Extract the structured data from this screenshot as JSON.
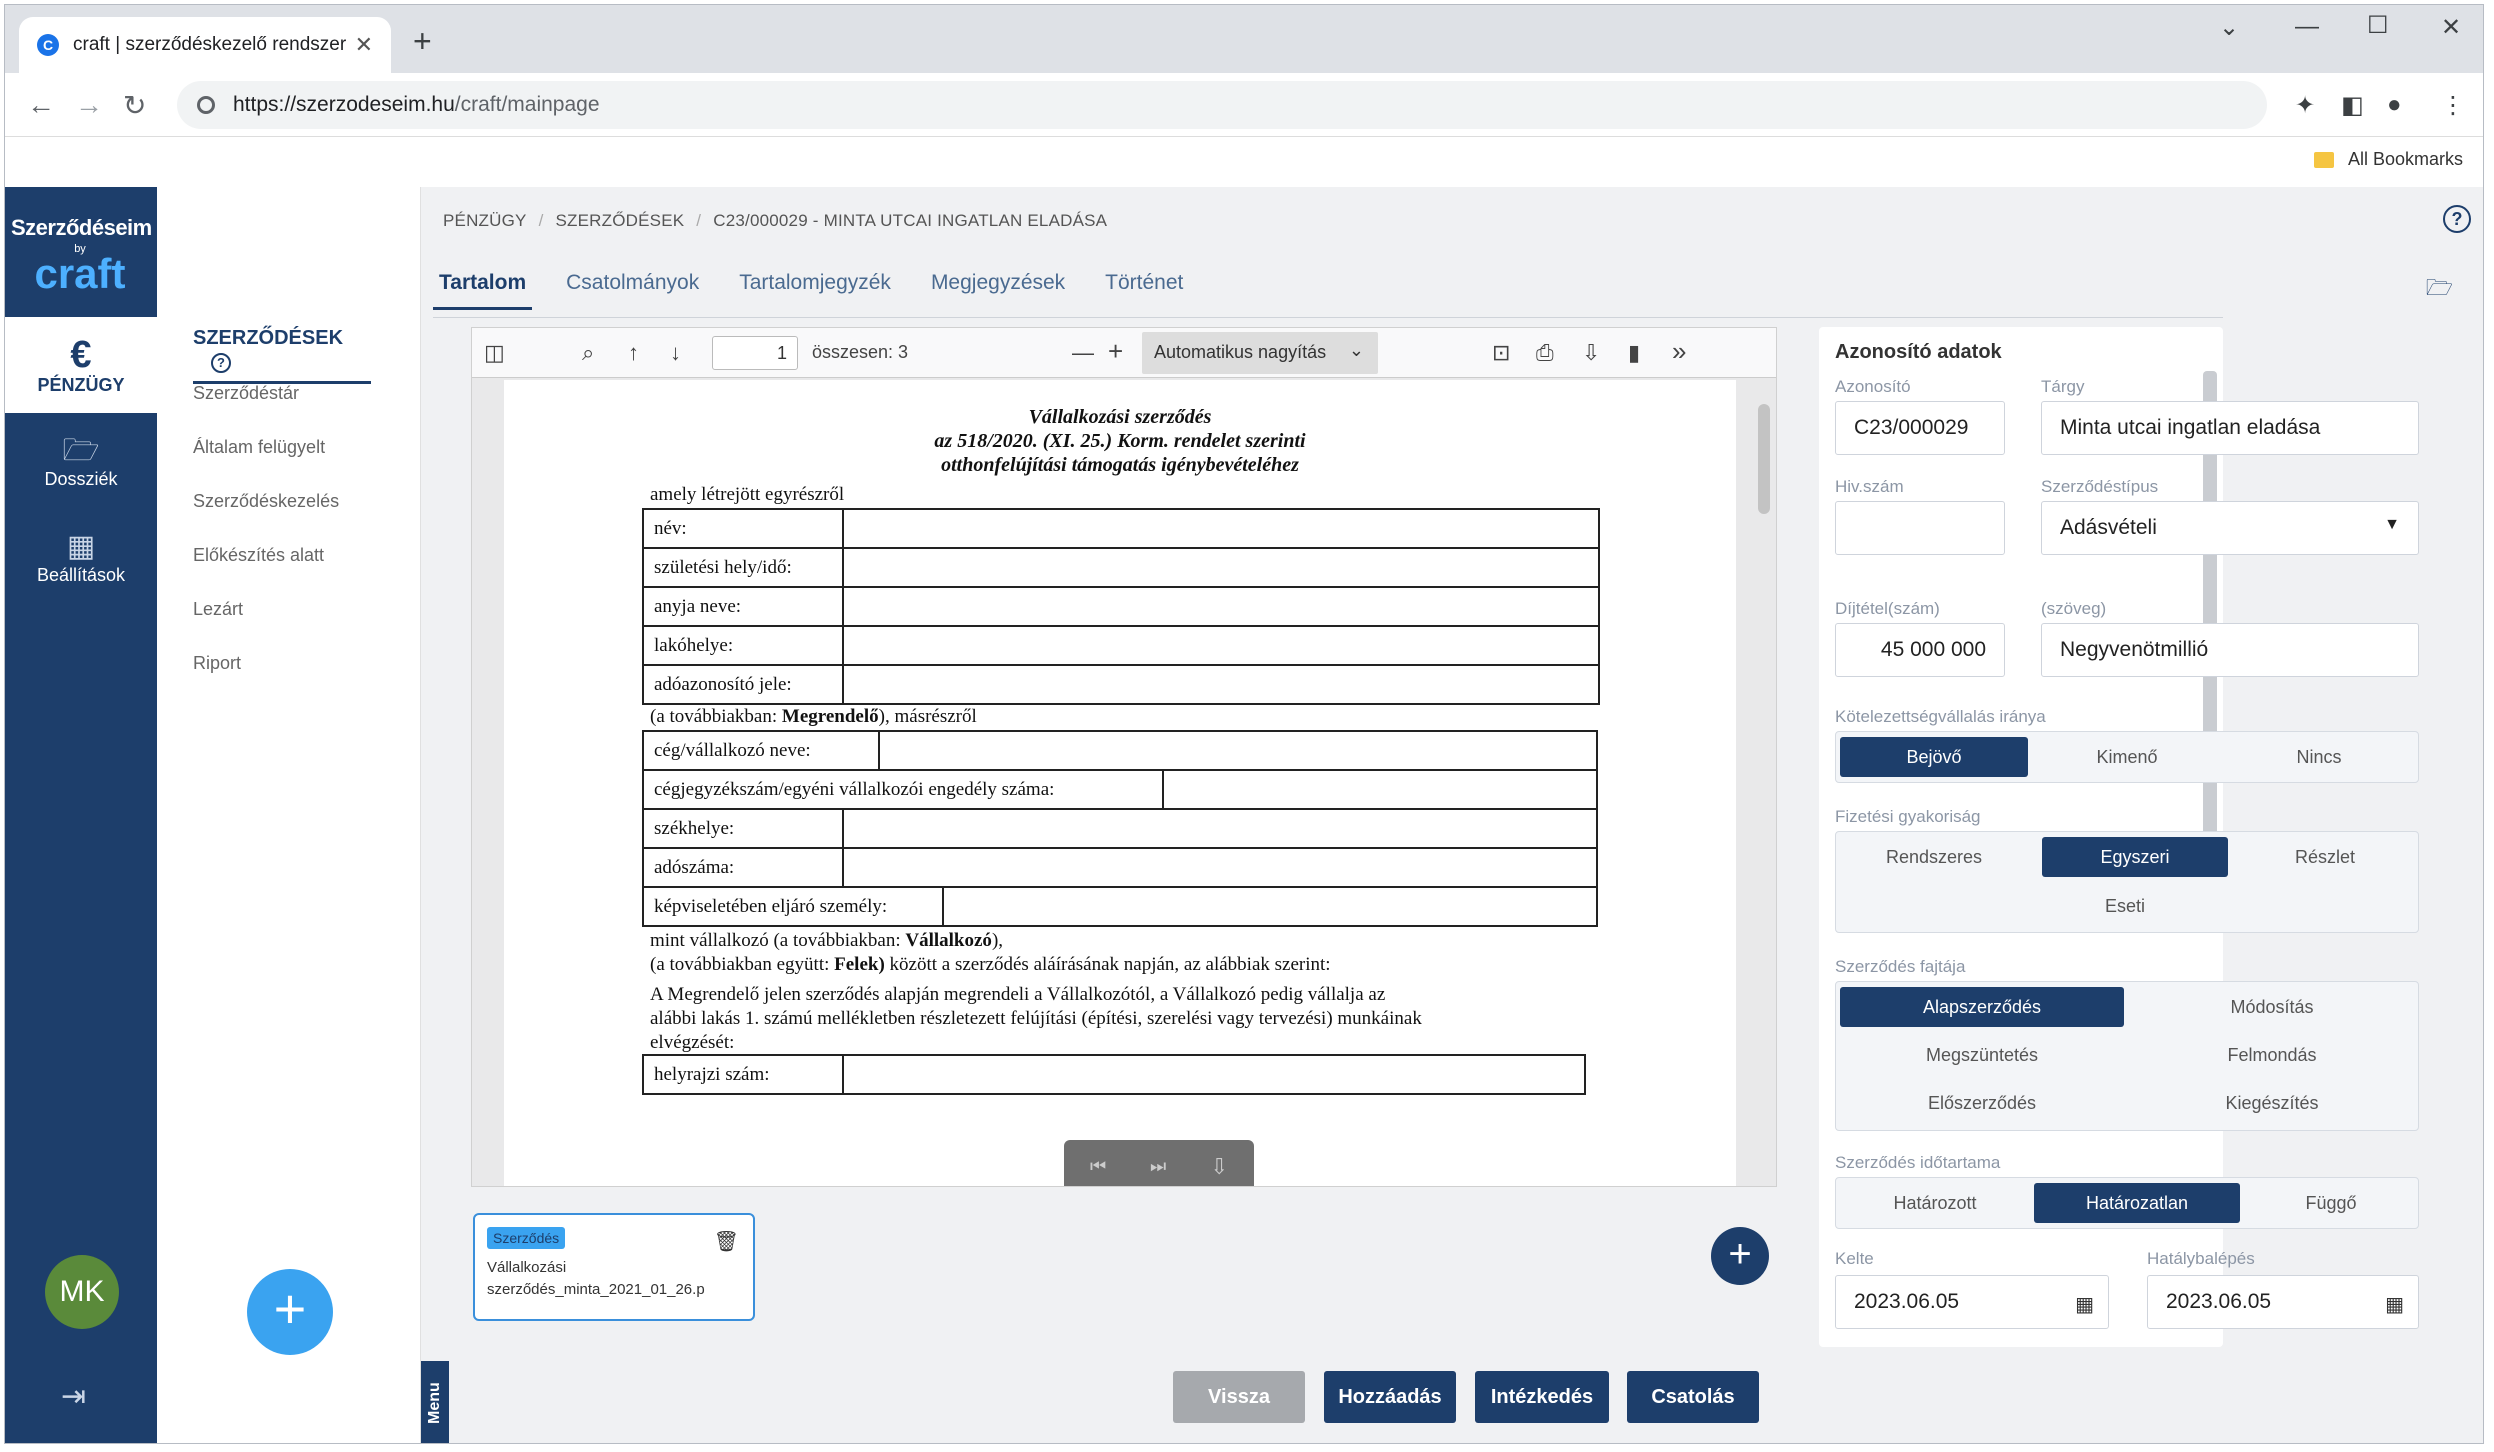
{
  "browser": {
    "tab_title": "craft | szerződéskezelő rendszer",
    "url_host": "https://szerzodeseim.hu",
    "url_path": "/craft/mainpage",
    "bookmarks_label": "All Bookmarks"
  },
  "rail": {
    "logo_line1": "Szerződéseim",
    "logo_line2": "by",
    "logo_line3": "craft",
    "items": [
      {
        "label": "PÉNZÜGY",
        "icon": "euro-icon"
      },
      {
        "label": "Dossziék",
        "icon": "folder-icon"
      },
      {
        "label": "Beállítások",
        "icon": "building-icon"
      }
    ],
    "avatar": "MK"
  },
  "sidebar": {
    "heading": "SZERZŐDÉSEK",
    "links": [
      "Szerződéstár",
      "Általam felügyelt",
      "Szerződéskezelés",
      "Előkészítés alatt",
      "Lezárt",
      "Riport"
    ]
  },
  "breadcrumb": [
    "PÉNZÜGY",
    "SZERZŐDÉSEK",
    "C23/000029 - MINTA UTCAI INGATLAN ELADÁSA"
  ],
  "tabs": [
    "Tartalom",
    "Csatolmányok",
    "Tartalomjegyzék",
    "Megjegyzések",
    "Történet"
  ],
  "viewer": {
    "page_number": "1",
    "page_total": "összesen: 3",
    "zoom": "Automatikus nagyítás"
  },
  "document": {
    "title1": "Vállalkozási szerződés",
    "title2": "az 518/2020. (XI. 25.) Korm. rendelet szerinti",
    "title3": "otthonfelújítási támogatás igénybevételéhez",
    "intro": "amely létrejött egyrészről",
    "party1_rows": [
      "név:",
      "születési hely/idő:",
      "anyja neve:",
      "lakóhelye:",
      "adóazonosító jele:"
    ],
    "party1_note_a": "(a továbbiakban: ",
    "party1_note_b": "Megrendelő",
    "party1_note_c": "), másrészről",
    "party2_rows": [
      "cég/vállalkozó neve:",
      "cégjegyzékszám/egyéni vállalkozói engedély száma:",
      "székhelye:",
      "adószáma:",
      "képviseletében eljáró személy:"
    ],
    "party2_note1_a": "mint vállalkozó (a továbbiakban: ",
    "party2_note1_b": "Vállalkozó",
    "party2_note1_c": "),",
    "party2_note2_a": " (a továbbiakban együtt: ",
    "party2_note2_b": "Felek)",
    "party2_note2_c": " között a szerződés aláírásának napján, az alábbiak szerint:",
    "body1": "A Megrendelő jelen szerződés alapján megrendeli a Vállalkozótól, a Vállalkozó pedig vállalja az",
    "body2": "alábbi lakás 1. számú mellékletben részletezett felújítási (építési, szerelési vagy tervezési) munkáinak",
    "body3": "elvégzését:",
    "last_row": "helyrajzi szám:"
  },
  "attachment": {
    "tag": "Szerződés",
    "filename1": "Vállalkozási",
    "filename2": "szerződés_minta_2021_01_26.p"
  },
  "form": {
    "heading": "Azonosító adatok",
    "azonosito_label": "Azonosító",
    "azonosito": "C23/000029",
    "targy_label": "Tárgy",
    "targy": "Minta utcai ingatlan eladása",
    "hivszam_label": "Hiv.szám",
    "hivszam": "",
    "tipus_label": "Szerződéstípus",
    "tipus": "Adásvételi",
    "dij_label": "Díjtétel(szám)",
    "dij": "45 000 000",
    "dijszoveg_label": "(szöveg)",
    "dijszoveg": "Negyvenötmillió",
    "irany_label": "Kötelezettségvállalás iránya",
    "irany": [
      "Bejövő",
      "Kimenő",
      "Nincs"
    ],
    "gyak_label": "Fizetési gyakoriság",
    "gyak": [
      "Rendszeres",
      "Egyszeri",
      "Részlet",
      "Eseti"
    ],
    "fajta_label": "Szerződés fajtája",
    "fajta": [
      "Alapszerződés",
      "Módosítás",
      "Megszüntetés",
      "Felmondás",
      "Előszerződés",
      "Kiegészítés"
    ],
    "idotartam_label": "Szerződés időtartama",
    "idotartam": [
      "Határozott",
      "Határozatlan",
      "Függő"
    ],
    "kelte_label": "Kelte",
    "kelte": "2023.06.05",
    "hataly_label": "Hatálybalépés",
    "hataly": "2023.06.05"
  },
  "bottom": {
    "menu": "Menu",
    "buttons": [
      "Vissza",
      "Hozzáadás",
      "Intézkedés",
      "Csatolás"
    ]
  }
}
